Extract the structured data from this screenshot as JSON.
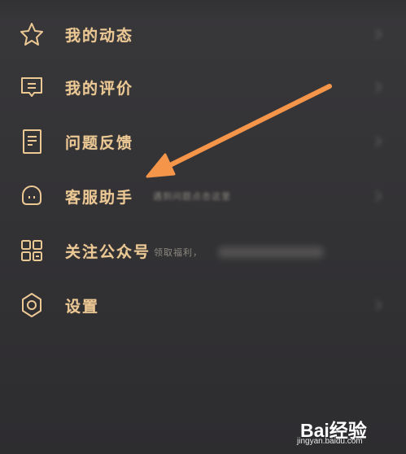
{
  "menu": {
    "items": [
      {
        "label": "我的动态",
        "icon": "star-icon"
      },
      {
        "label": "我的评价",
        "icon": "comment-icon"
      },
      {
        "label": "问题反馈",
        "icon": "feedback-document-icon"
      },
      {
        "label": "客服助手",
        "icon": "headset-icon",
        "hint": "遇到问题点击这里"
      },
      {
        "label": "关注公众号",
        "icon": "grid-apps-icon",
        "hint": "领取福利，"
      },
      {
        "label": "设置",
        "icon": "settings-gear-icon"
      }
    ]
  },
  "annotation": {
    "type": "arrow",
    "color": "#f4954a",
    "points_to": "客服助手"
  },
  "watermark": {
    "logo": "Bai经验",
    "url": "jingyan.baidu.com"
  },
  "colors": {
    "label": "#ecc894",
    "background": "#343336"
  }
}
